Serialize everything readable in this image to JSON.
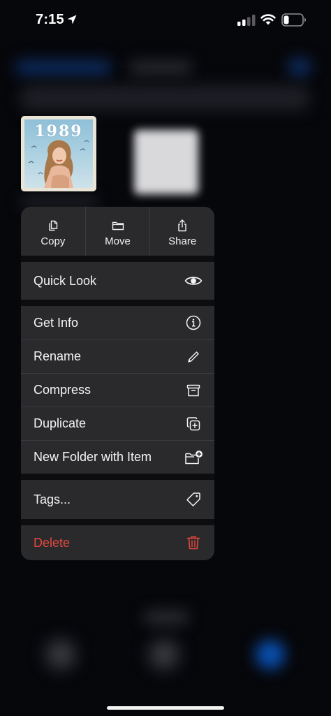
{
  "status_bar": {
    "time": "7:15"
  },
  "album": {
    "title": "1989"
  },
  "actions": [
    {
      "label": "Copy",
      "icon": "copy-icon"
    },
    {
      "label": "Move",
      "icon": "folder-icon"
    },
    {
      "label": "Share",
      "icon": "share-icon"
    }
  ],
  "menu": {
    "quick_look": {
      "label": "Quick Look",
      "icon": "eye-icon"
    },
    "get_info": {
      "label": "Get Info",
      "icon": "info-icon"
    },
    "rename": {
      "label": "Rename",
      "icon": "pencil-icon"
    },
    "compress": {
      "label": "Compress",
      "icon": "archive-box-icon"
    },
    "duplicate": {
      "label": "Duplicate",
      "icon": "duplicate-icon"
    },
    "new_folder": {
      "label": "New Folder with Item",
      "icon": "folder-plus-icon"
    },
    "tags": {
      "label": "Tags...",
      "icon": "tag-icon"
    },
    "delete": {
      "label": "Delete",
      "icon": "trash-icon"
    }
  },
  "colors": {
    "menu_background": "#2a2a2d",
    "destructive": "#e5483d",
    "accent_blue": "#0a84ff"
  }
}
